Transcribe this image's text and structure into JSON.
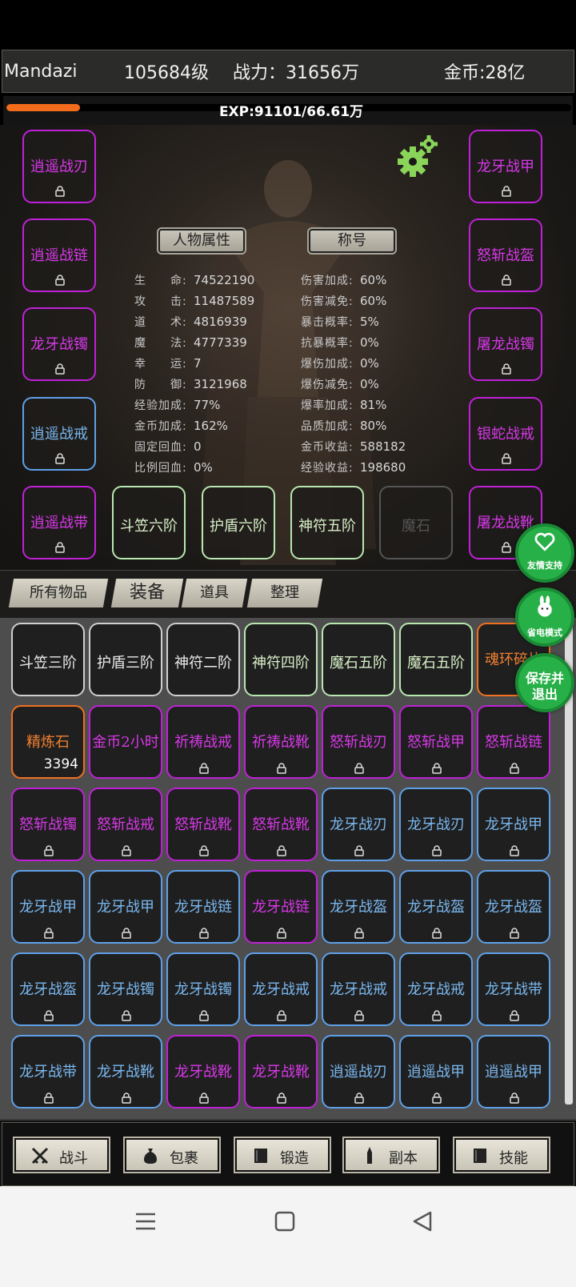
{
  "header": {
    "name": "Mandazi",
    "level": "105684级",
    "power": "战力：31656万",
    "gold": "金币:28亿"
  },
  "exp": {
    "text": "EXP:91101/66.61万",
    "progress_percent": 13
  },
  "char_tabs": {
    "attributes": "人物属性",
    "title": "称号"
  },
  "equip_left": [
    {
      "label": "逍遥战刃",
      "rarity": "purple"
    },
    {
      "label": "逍遥战链",
      "rarity": "purple"
    },
    {
      "label": "龙牙战镯",
      "rarity": "purple"
    },
    {
      "label": "逍遥战戒",
      "rarity": "blue"
    },
    {
      "label": "逍遥战带",
      "rarity": "purple"
    }
  ],
  "equip_right": [
    {
      "label": "龙牙战甲",
      "rarity": "purple"
    },
    {
      "label": "怒斩战盔",
      "rarity": "purple"
    },
    {
      "label": "屠龙战镯",
      "rarity": "purple"
    },
    {
      "label": "银蛇战戒",
      "rarity": "purple"
    },
    {
      "label": "屠龙战靴",
      "rarity": "purple"
    }
  ],
  "equip_bottom": [
    "斗笠六阶",
    "护盾六阶",
    "神符五阶",
    "魔石"
  ],
  "stats_left": [
    {
      "k": "生　　命:",
      "v": "74522190"
    },
    {
      "k": "攻　　击:",
      "v": "11487589"
    },
    {
      "k": "道　　术:",
      "v": "4816939"
    },
    {
      "k": "魔　　法:",
      "v": "4777339"
    },
    {
      "k": "幸　　运:",
      "v": "7"
    },
    {
      "k": "防　　御:",
      "v": "3121968"
    },
    {
      "k": "经验加成:",
      "v": "77%"
    },
    {
      "k": "金币加成:",
      "v": "162%"
    },
    {
      "k": "固定回血:",
      "v": "0"
    },
    {
      "k": "比例回血:",
      "v": "0%"
    }
  ],
  "stats_right": [
    {
      "k": "伤害加成:",
      "v": "60%"
    },
    {
      "k": "伤害减免:",
      "v": "60%"
    },
    {
      "k": "暴击概率:",
      "v": "5%"
    },
    {
      "k": "抗暴概率:",
      "v": "0%"
    },
    {
      "k": "爆伤加成:",
      "v": "0%"
    },
    {
      "k": "爆伤减免:",
      "v": "0%"
    },
    {
      "k": "爆率加成:",
      "v": "81%"
    },
    {
      "k": "品质加成:",
      "v": "80%"
    },
    {
      "k": "金币收益:",
      "v": "588182"
    },
    {
      "k": "经验收益:",
      "v": "198680"
    }
  ],
  "bag_tabs": [
    "所有物品",
    "装备",
    "道具",
    "整理"
  ],
  "bag_items": [
    {
      "label": "斗笠三阶",
      "rarity": "white"
    },
    {
      "label": "护盾三阶",
      "rarity": "white"
    },
    {
      "label": "神符二阶",
      "rarity": "white"
    },
    {
      "label": "神符四阶",
      "rarity": "green"
    },
    {
      "label": "魔石五阶",
      "rarity": "green"
    },
    {
      "label": "魔石五阶",
      "rarity": "green"
    },
    {
      "label": "魂环碎片",
      "rarity": "orange"
    },
    {
      "label": "精炼石",
      "rarity": "orange",
      "count": "3394"
    },
    {
      "label": "金币2小时",
      "rarity": "purple"
    },
    {
      "label": "祈祷战戒",
      "rarity": "purple",
      "locked": true
    },
    {
      "label": "祈祷战靴",
      "rarity": "purple",
      "locked": true
    },
    {
      "label": "怒斩战刃",
      "rarity": "purple",
      "locked": true
    },
    {
      "label": "怒斩战甲",
      "rarity": "purple",
      "locked": true
    },
    {
      "label": "怒斩战链",
      "rarity": "purple",
      "locked": true
    },
    {
      "label": "怒斩战镯",
      "rarity": "purple",
      "locked": true
    },
    {
      "label": "怒斩战戒",
      "rarity": "purple",
      "locked": true
    },
    {
      "label": "怒斩战靴",
      "rarity": "purple",
      "locked": true
    },
    {
      "label": "怒斩战靴",
      "rarity": "purple",
      "locked": true
    },
    {
      "label": "龙牙战刃",
      "rarity": "blue",
      "locked": true
    },
    {
      "label": "龙牙战刃",
      "rarity": "blue",
      "locked": true
    },
    {
      "label": "龙牙战甲",
      "rarity": "blue",
      "locked": true
    },
    {
      "label": "龙牙战甲",
      "rarity": "blue",
      "locked": true
    },
    {
      "label": "龙牙战甲",
      "rarity": "blue",
      "locked": true
    },
    {
      "label": "龙牙战链",
      "rarity": "blue",
      "locked": true
    },
    {
      "label": "龙牙战链",
      "rarity": "purple",
      "locked": true
    },
    {
      "label": "龙牙战盔",
      "rarity": "blue",
      "locked": true
    },
    {
      "label": "龙牙战盔",
      "rarity": "blue",
      "locked": true
    },
    {
      "label": "龙牙战盔",
      "rarity": "blue",
      "locked": true
    },
    {
      "label": "龙牙战盔",
      "rarity": "blue",
      "locked": true
    },
    {
      "label": "龙牙战镯",
      "rarity": "blue",
      "locked": true
    },
    {
      "label": "龙牙战镯",
      "rarity": "blue",
      "locked": true
    },
    {
      "label": "龙牙战戒",
      "rarity": "blue",
      "locked": true
    },
    {
      "label": "龙牙战戒",
      "rarity": "blue",
      "locked": true
    },
    {
      "label": "龙牙战戒",
      "rarity": "blue",
      "locked": true
    },
    {
      "label": "龙牙战带",
      "rarity": "blue",
      "locked": true
    },
    {
      "label": "龙牙战带",
      "rarity": "blue",
      "locked": true
    },
    {
      "label": "龙牙战靴",
      "rarity": "blue",
      "locked": true
    },
    {
      "label": "龙牙战靴",
      "rarity": "purple",
      "locked": true
    },
    {
      "label": "龙牙战靴",
      "rarity": "purple",
      "locked": true
    },
    {
      "label": "逍遥战刃",
      "rarity": "blue",
      "locked": true
    },
    {
      "label": "逍遥战甲",
      "rarity": "blue",
      "locked": true
    },
    {
      "label": "逍遥战甲",
      "rarity": "blue",
      "locked": true
    }
  ],
  "float_buttons": {
    "support": "友情支持",
    "power_save": "省电模式",
    "save_exit_1": "保存并",
    "save_exit_2": "退出"
  },
  "bottom_nav": [
    {
      "label": "战斗",
      "icon": "crossed-swords-icon"
    },
    {
      "label": "包裹",
      "icon": "bag-icon"
    },
    {
      "label": "锻造",
      "icon": "book-icon"
    },
    {
      "label": "副本",
      "icon": "tower-icon"
    },
    {
      "label": "技能",
      "icon": "book-icon"
    }
  ],
  "colors": {
    "purple": "#d838e8",
    "blue": "#7ab8f0",
    "orange": "#f08030",
    "green": "#d8f0c8",
    "exp_fill": "#f26c1c"
  }
}
